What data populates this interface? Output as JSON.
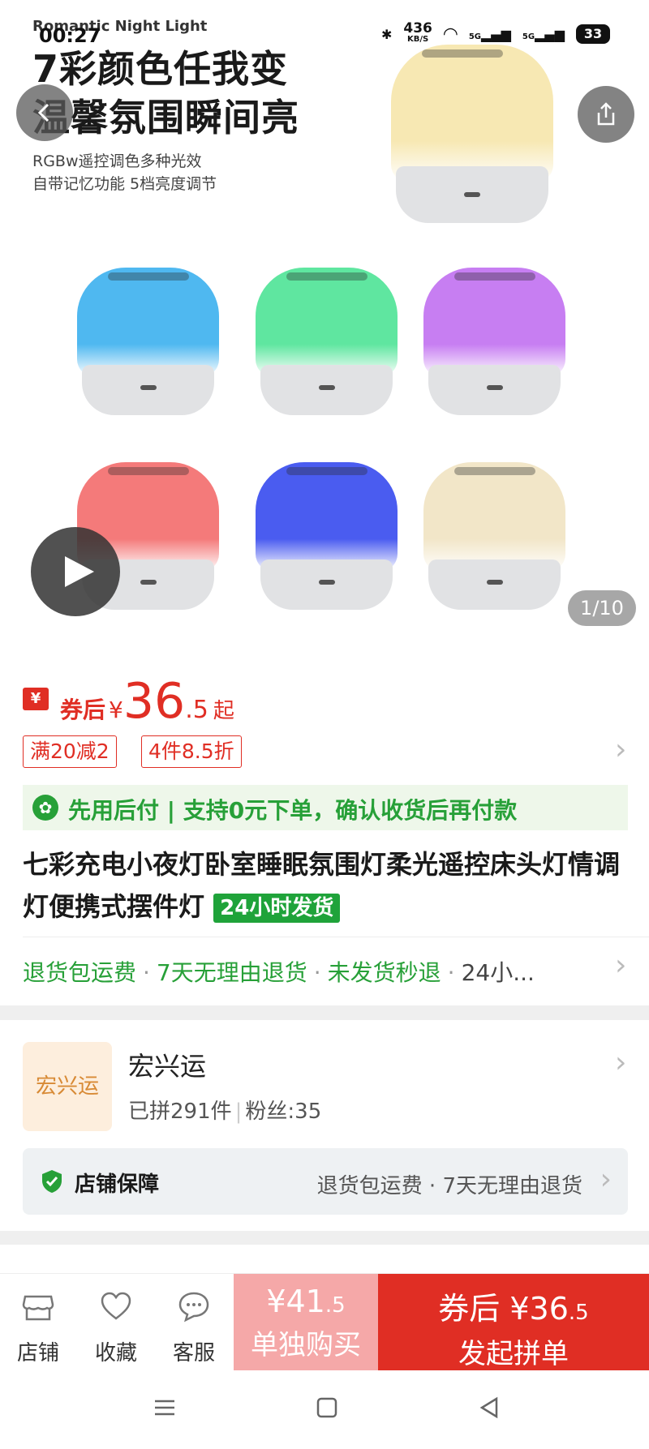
{
  "status_bar": {
    "time": "00:27",
    "speed": "436",
    "speed_unit": "KB/S",
    "net1": "5G",
    "net2": "5G",
    "battery": "33"
  },
  "hero": {
    "brand": "Romantic Night Light",
    "headline_1": "7彩颜色任我变",
    "headline_2": "温馨氛围瞬间亮",
    "sub_1": "RGBw遥控调色多种光效",
    "sub_2": "自带记忆功能 5档亮度调节",
    "counter": "1/10",
    "lamp_colors": [
      "#f7e8b3",
      "#4fb8f0",
      "#5fe6a0",
      "#c77ef2",
      "#f47a7a",
      "#4a5cf0",
      "#f2e6c8"
    ]
  },
  "price": {
    "coupon_icon": "¥",
    "label": "券后",
    "currency": "¥",
    "integer": "36",
    "decimal": ".5",
    "suffix": "起",
    "promos": [
      "满20减2",
      "4件8.5折"
    ]
  },
  "paylater": {
    "text": "先用后付 | 支持0元下单，确认收货后再付款"
  },
  "product": {
    "title": "七彩充电小夜灯卧室睡眠氛围灯柔光遥控床头灯情调灯便携式摆件灯",
    "ship_badge": "24小时发货"
  },
  "services": [
    "退货包运费",
    "7天无理由退货",
    "未发货秒退",
    "24小..."
  ],
  "store": {
    "logo_text": "宏兴运",
    "name": "宏兴运",
    "sold": "已拼291件",
    "fans": "粉丝:35",
    "guarantee_label": "店铺保障",
    "guarantee_items": "退货包运费 · 7天无理由退货"
  },
  "bottom_bar": {
    "store": "店铺",
    "favorite": "收藏",
    "service": "客服",
    "alone_currency": "¥",
    "alone_int": "41",
    "alone_dec": ".5",
    "alone_label": "单独购买",
    "group_price": "券后 ¥36",
    "group_dec": ".5",
    "group_label": "发起拼单"
  }
}
